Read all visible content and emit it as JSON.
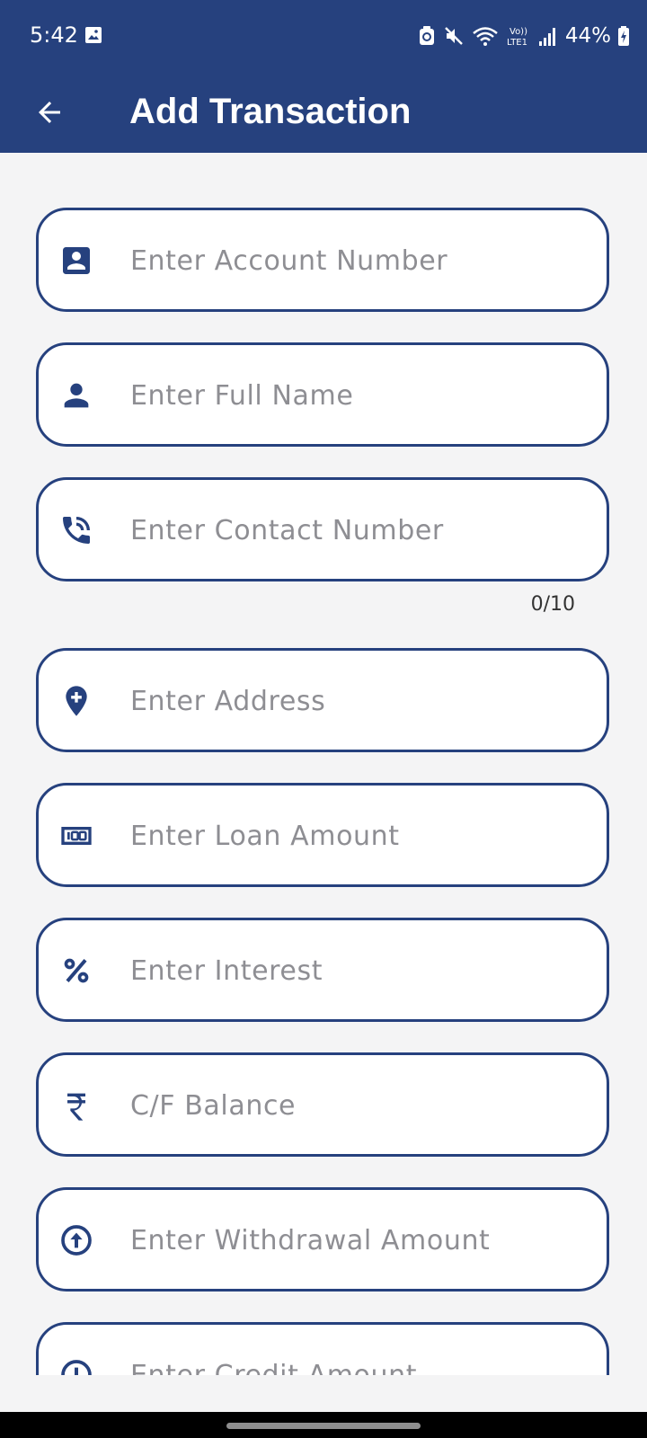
{
  "status_bar": {
    "time": "5:42",
    "battery": "44%",
    "icons": [
      "gallery-icon",
      "clean-icon",
      "mute-icon",
      "wifi-icon",
      "volte-icon",
      "signal-icon",
      "battery-icon"
    ]
  },
  "app_bar": {
    "title": "Add Transaction",
    "back_icon": "arrow-left-icon"
  },
  "form": {
    "fields": [
      {
        "icon": "account-box-icon",
        "placeholder": "Enter Account Number",
        "value": ""
      },
      {
        "icon": "person-icon",
        "placeholder": "Enter Full Name",
        "value": ""
      },
      {
        "icon": "phone-call-icon",
        "placeholder": "Enter Contact Number",
        "value": "",
        "counter": "0/10"
      },
      {
        "icon": "location-add-icon",
        "placeholder": "Enter Address",
        "value": ""
      },
      {
        "icon": "money-100-icon",
        "placeholder": "Enter Loan Amount",
        "value": ""
      },
      {
        "icon": "percent-icon",
        "placeholder": "Enter Interest",
        "value": ""
      },
      {
        "icon": "rupee-icon",
        "placeholder": "C/F Balance",
        "value": ""
      },
      {
        "icon": "arrow-up-circle-icon",
        "placeholder": "Enter Withdrawal Amount",
        "value": ""
      },
      {
        "icon": "arrow-down-circle-icon",
        "placeholder": "Enter Credit Amount",
        "value": ""
      }
    ]
  },
  "colors": {
    "primary": "#26417e",
    "background": "#f4f4f5",
    "placeholder": "#8e8e93"
  }
}
